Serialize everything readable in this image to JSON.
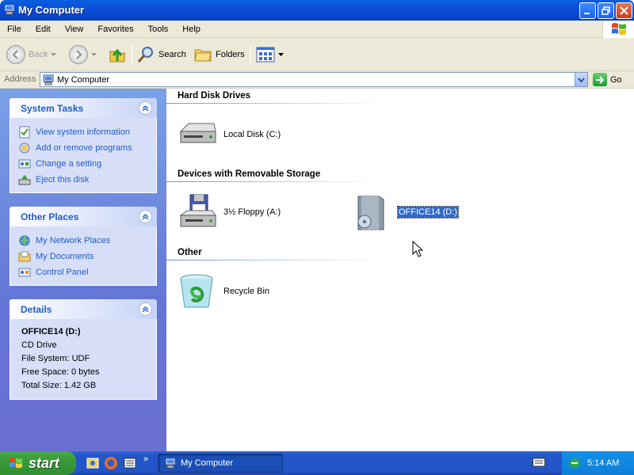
{
  "window": {
    "title": "My Computer"
  },
  "menu": [
    "File",
    "Edit",
    "View",
    "Favorites",
    "Tools",
    "Help"
  ],
  "toolbar": {
    "back": "Back",
    "search": "Search",
    "folders": "Folders"
  },
  "address": {
    "label": "Address",
    "value": "My Computer",
    "go": "Go"
  },
  "system_tasks": {
    "title": "System Tasks",
    "items": [
      "View system information",
      "Add or remove programs",
      "Change a setting",
      "Eject this disk"
    ]
  },
  "other_places": {
    "title": "Other Places",
    "items": [
      "My Network Places",
      "My Documents",
      "Control Panel"
    ]
  },
  "details": {
    "title": "Details",
    "name": "OFFICE14 (D:)",
    "type": "CD Drive",
    "file_system": "File System: UDF",
    "free_space": "Free Space: 0 bytes",
    "total_size": "Total Size: 1.42 GB"
  },
  "groups": {
    "hard_disk": {
      "title": "Hard Disk Drives",
      "items": [
        "Local Disk (C:)"
      ]
    },
    "removable": {
      "title": "Devices with Removable Storage",
      "items": [
        "3½ Floppy (A:)",
        "OFFICE14 (D:)"
      ]
    },
    "other": {
      "title": "Other",
      "items": [
        "Recycle Bin"
      ]
    }
  },
  "taskbar": {
    "start": "start",
    "active_window": "My Computer",
    "clock": "5:14 AM"
  }
}
